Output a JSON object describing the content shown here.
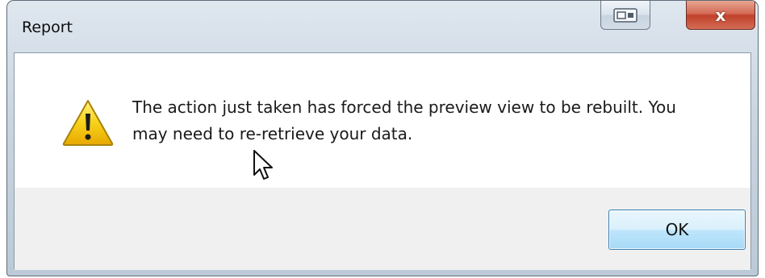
{
  "window": {
    "title": "Report"
  },
  "titlebar_buttons": {
    "restore_icon": "restore-icon",
    "close_icon": "close-icon",
    "close_glyph": "x"
  },
  "message": {
    "icon": "warning-icon",
    "text": "The action just taken has forced the preview view to be rebuilt. You may need to re-retrieve your data."
  },
  "buttons": {
    "ok_label": "OK"
  },
  "colors": {
    "accent": "#3c7fb1",
    "warning": "#f5c500",
    "close": "#c0412b"
  }
}
